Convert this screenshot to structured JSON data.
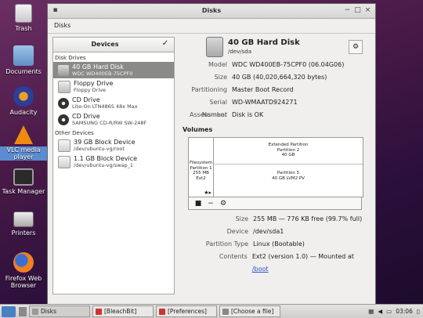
{
  "desktop": {
    "icons": [
      {
        "label": "Trash"
      },
      {
        "label": "Documents"
      },
      {
        "label": "Audacity"
      },
      {
        "label": "VLC media player"
      },
      {
        "label": "Task Manager"
      },
      {
        "label": "Printers"
      },
      {
        "label": "Firefox Web Browser"
      }
    ]
  },
  "window": {
    "title": "Disks",
    "menu": "Disks",
    "devices_header": "Devices",
    "groups": {
      "disk_drives": "Disk Drives",
      "other_devices": "Other Devices"
    },
    "devices": [
      {
        "title": "40 GB Hard Disk",
        "sub": "WDC WD400EB-75CPF0"
      },
      {
        "title": "Floppy Drive",
        "sub": "Floppy Drive"
      },
      {
        "title": "CD Drive",
        "sub": "Lite-On LTN486S 48x Max"
      },
      {
        "title": "CD Drive",
        "sub": "SAMSUNG CD-R/RW SW-248F"
      },
      {
        "title": "39 GB Block Device",
        "sub": "/dev/ubuntu-vg/root"
      },
      {
        "title": "1.1 GB Block Device",
        "sub": "/dev/ubuntu-vg/swap_1"
      }
    ],
    "disk": {
      "name": "40 GB Hard Disk",
      "path": "/dev/sda",
      "props": [
        {
          "key": "Model",
          "value": "WDC WD400EB-75CPF0 (06.04G06)"
        },
        {
          "key": "Size",
          "value": "40 GB (40,020,664,320 bytes)"
        },
        {
          "key": "Partitioning",
          "value": "Master Boot Record"
        },
        {
          "key": "Serial Number",
          "value": "WD-WMAATD924271"
        },
        {
          "key": "Assessment",
          "value": "Disk is OK"
        }
      ]
    },
    "volumes_label": "Volumes",
    "graph": {
      "p1": [
        "Filesystem",
        "Partition 1",
        "255 MB Ext2"
      ],
      "ext": [
        "Extended Partition",
        "Partition 2",
        "40 GB"
      ],
      "p5": [
        "Partition 5",
        "40 GB LVM2 PV"
      ],
      "stars": "★▸"
    },
    "partition": {
      "props": [
        {
          "key": "Size",
          "value": "255 MB — 776 KB free (99.7% full)"
        },
        {
          "key": "Device",
          "value": "/dev/sda1"
        },
        {
          "key": "Partition Type",
          "value": "Linux (Bootable)"
        }
      ],
      "contents_key": "Contents",
      "contents_text": "Ext2 (version 1.0) — Mounted at ",
      "contents_link": "/boot"
    }
  },
  "taskbar": {
    "tasks": [
      "Disks",
      "[BleachBit]",
      "[Preferences]",
      "[Choose a file]"
    ],
    "clock": "03:06"
  }
}
